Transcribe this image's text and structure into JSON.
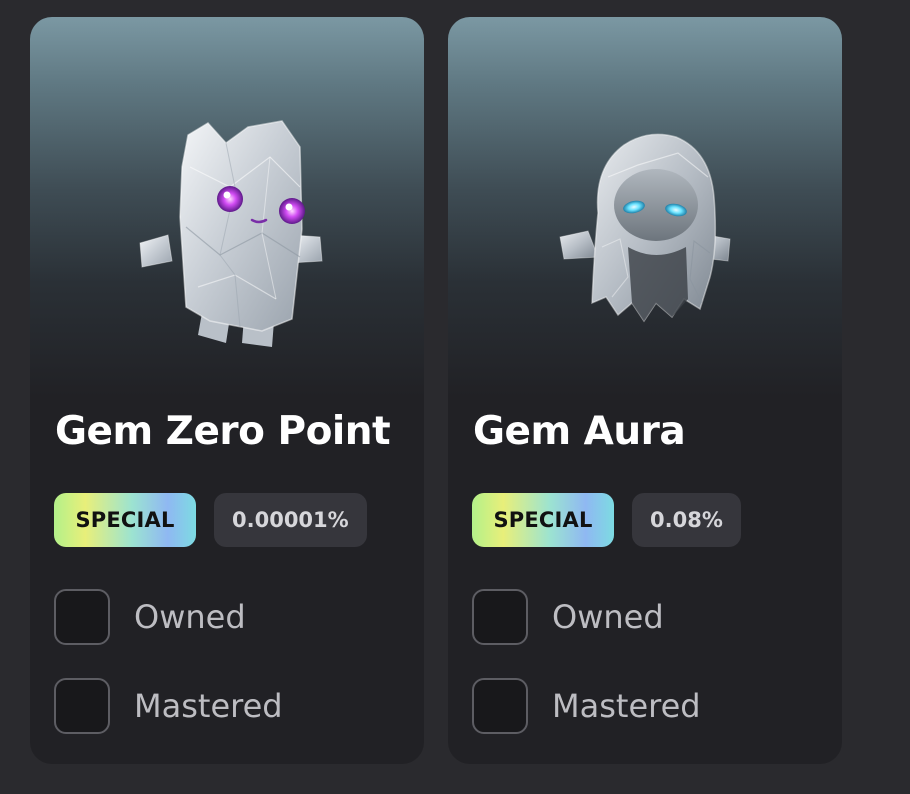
{
  "cards": [
    {
      "title": "Gem Zero Point",
      "rarity_label": "SPECIAL",
      "chance": "0.00001%",
      "owned_label": "Owned",
      "mastered_label": "Mastered",
      "owned": false,
      "mastered": false,
      "image": "crystal-cat-creature"
    },
    {
      "title": "Gem Aura",
      "rarity_label": "SPECIAL",
      "chance": "0.08%",
      "owned_label": "Owned",
      "mastered_label": "Mastered",
      "owned": false,
      "mastered": false,
      "image": "crystal-hooded-creature"
    }
  ],
  "colors": {
    "background": "#2a2a2e",
    "card": "#212125",
    "pill": "#36363c",
    "eye_card1": "#c13cf0",
    "eye_card2": "#6ae3ff"
  }
}
